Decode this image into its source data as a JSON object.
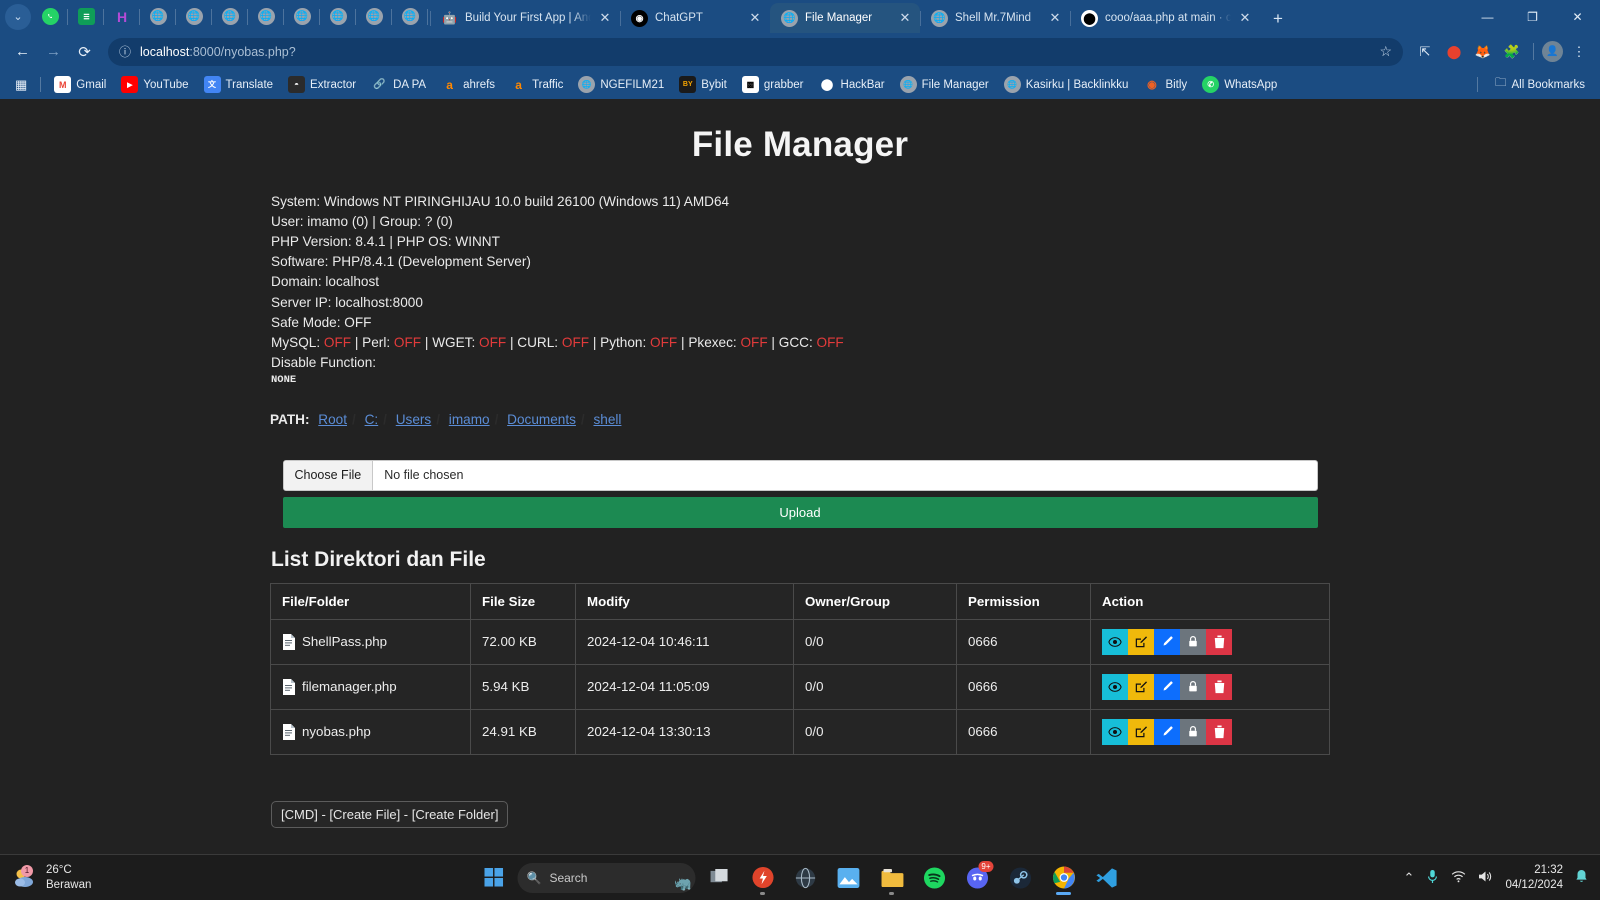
{
  "browser": {
    "pinned_tabs": [
      {
        "name": "whatsapp-pinned-tab",
        "icon": "whatsapp-icon"
      },
      {
        "name": "sheets-pinned-tab",
        "icon": "sheets-icon"
      },
      {
        "name": "h-pinned-tab",
        "icon": "h-icon"
      },
      {
        "name": "globe-pinned-tab-1",
        "icon": "globe-icon"
      },
      {
        "name": "globe-pinned-tab-2",
        "icon": "globe-icon"
      },
      {
        "name": "globe-pinned-tab-3",
        "icon": "globe-icon"
      },
      {
        "name": "globe-pinned-tab-4",
        "icon": "globe-icon"
      },
      {
        "name": "globe-pinned-tab-5",
        "icon": "globe-icon"
      },
      {
        "name": "globe-pinned-tab-6",
        "icon": "globe-icon"
      },
      {
        "name": "globe-pinned-tab-7",
        "icon": "globe-icon"
      },
      {
        "name": "globe-pinned-tab-8",
        "icon": "globe-icon"
      }
    ],
    "tabs": [
      {
        "title": "Build Your First App | Android",
        "icon": "android-icon",
        "active": false
      },
      {
        "title": "ChatGPT",
        "icon": "openai-icon",
        "active": false
      },
      {
        "title": "File Manager",
        "icon": "globe-icon",
        "active": true
      },
      {
        "title": "Shell Mr.7Mind",
        "icon": "globe-icon",
        "active": false
      },
      {
        "title": "cooo/aaa.php at main · chmod",
        "icon": "github-icon",
        "active": false
      }
    ],
    "new_tab_label": "+",
    "tab_close_label": "✕",
    "window_controls": {
      "minimize": "—",
      "maximize": "❐",
      "close": "✕"
    },
    "nav": {
      "back": "←",
      "forward": "→",
      "reload": "⟳"
    },
    "omnibox": {
      "info_icon": "info-circle-icon",
      "url_host": "localhost",
      "url_path": ":8000/nyobas.php?",
      "bookmark_star": "☆"
    },
    "toolbar_icons": [
      "split-screen-icon",
      "adblock-icon",
      "extension-fox-icon",
      "extensions-puzzle-icon",
      "profile-avatar",
      "kebab-menu-icon"
    ],
    "bookmarks": [
      {
        "label": "Gmail",
        "icon": "gmail-icon"
      },
      {
        "label": "YouTube",
        "icon": "youtube-icon"
      },
      {
        "label": "Translate",
        "icon": "translate-icon"
      },
      {
        "label": "Extractor",
        "icon": "extractor-icon"
      },
      {
        "label": "DA PA",
        "icon": "link-icon"
      },
      {
        "label": "ahrefs",
        "icon": "ahrefs-icon"
      },
      {
        "label": "Traffic",
        "icon": "ahrefs-icon"
      },
      {
        "label": "NGEFILM21",
        "icon": "globe-icon"
      },
      {
        "label": "Bybit",
        "icon": "bybit-icon"
      },
      {
        "label": "grabber",
        "icon": "grabber-icon"
      },
      {
        "label": "HackBar",
        "icon": "github-icon"
      },
      {
        "label": "File Manager",
        "icon": "globe-icon"
      },
      {
        "label": "Kasirku | Backlinkku",
        "icon": "globe-icon"
      },
      {
        "label": "Bitly",
        "icon": "bitly-icon"
      },
      {
        "label": "WhatsApp",
        "icon": "whatsapp-icon"
      }
    ],
    "all_bookmarks_label": "All Bookmarks",
    "apps_grid_icon": "apps-grid-icon",
    "folder_icon": "folder-icon"
  },
  "page": {
    "title": "File Manager",
    "sysinfo": {
      "system": "System: Windows NT PIRINGHIJAU 10.0 build 26100 (Windows 11) AMD64",
      "user": "User: imamo (0) | Group: ? (0)",
      "php_version": "PHP Version: 8.4.1 | PHP OS: WINNT",
      "software": "Software: PHP/8.4.1 (Development Server)",
      "domain": "Domain: localhost",
      "server_ip": "Server IP: localhost:8000",
      "safe_mode": "Safe Mode: OFF",
      "binaries_label_mysql": "MySQL:",
      "binaries_label_perl": "Perl:",
      "binaries_label_wget": "WGET:",
      "binaries_label_curl": "CURL:",
      "binaries_label_python": "Python:",
      "binaries_label_pkexec": "Pkexec:",
      "binaries_label_gcc": "GCC:",
      "off_value": "OFF",
      "disable_function_label": "Disable Function:",
      "disable_function_value": "NONE"
    },
    "path": {
      "label": "PATH:",
      "segments": [
        "Root",
        "C:",
        "Users",
        "imamo",
        "Documents",
        "shell"
      ]
    },
    "upload": {
      "choose_file_label": "Choose File",
      "no_file_text": "No file chosen",
      "upload_button_label": "Upload"
    },
    "list": {
      "heading": "List Direktori dan File",
      "columns": [
        "File/Folder",
        "File Size",
        "Modify",
        "Owner/Group",
        "Permission",
        "Action"
      ],
      "rows": [
        {
          "name": "ShellPass.php",
          "size": "72.00 KB",
          "modify": "2024-12-04 10:46:11",
          "owner": "0/0",
          "permission": "0666"
        },
        {
          "name": "filemanager.php",
          "size": "5.94 KB",
          "modify": "2024-12-04 11:05:09",
          "owner": "0/0",
          "permission": "0666"
        },
        {
          "name": "nyobas.php",
          "size": "24.91 KB",
          "modify": "2024-12-04 13:30:13",
          "owner": "0/0",
          "permission": "0666"
        }
      ],
      "action_icons": [
        "eye-icon",
        "edit-square-icon",
        "pencil-icon",
        "lock-icon",
        "trash-icon"
      ]
    },
    "cmdbar": "[CMD] - [Create File] - [Create Folder]",
    "colors": {
      "accent_green": "#1c8a52",
      "link_blue": "#5b8dd6",
      "off_red": "#e23b3b",
      "action_view": "#17bed8",
      "action_edit": "#f0b90b",
      "action_rename": "#0d6efd",
      "action_perm": "#6c757d",
      "action_delete": "#dc3545",
      "page_bg": "#222222"
    }
  },
  "taskbar": {
    "weather": {
      "temp": "26°C",
      "condition": "Berawan",
      "badge": "1"
    },
    "search_placeholder": "Search",
    "apps": [
      {
        "name": "start-button",
        "icon": "windows-logo"
      },
      {
        "name": "taskview-button",
        "icon": "task-view-icon"
      },
      {
        "name": "taskbar-app-firealpaca",
        "icon": "fire-icon"
      },
      {
        "name": "taskbar-app-browser",
        "icon": "globe-dark-icon"
      },
      {
        "name": "taskbar-app-photos",
        "icon": "photos-icon"
      },
      {
        "name": "taskbar-app-explorer",
        "icon": "folder-icon"
      },
      {
        "name": "taskbar-app-spotify",
        "icon": "spotify-icon"
      },
      {
        "name": "taskbar-app-discord",
        "icon": "discord-icon",
        "badge": "9+"
      },
      {
        "name": "taskbar-app-steam",
        "icon": "steam-icon"
      },
      {
        "name": "taskbar-app-chrome",
        "icon": "chrome-icon"
      },
      {
        "name": "taskbar-app-vscode",
        "icon": "vscode-icon"
      }
    ],
    "tray": {
      "chevron": "⌃",
      "mic": "mic-icon",
      "wifi": "wifi-icon",
      "volume": "volume-icon",
      "bell": "bell-icon"
    },
    "clock": {
      "time": "21:32",
      "date": "04/12/2024"
    }
  }
}
